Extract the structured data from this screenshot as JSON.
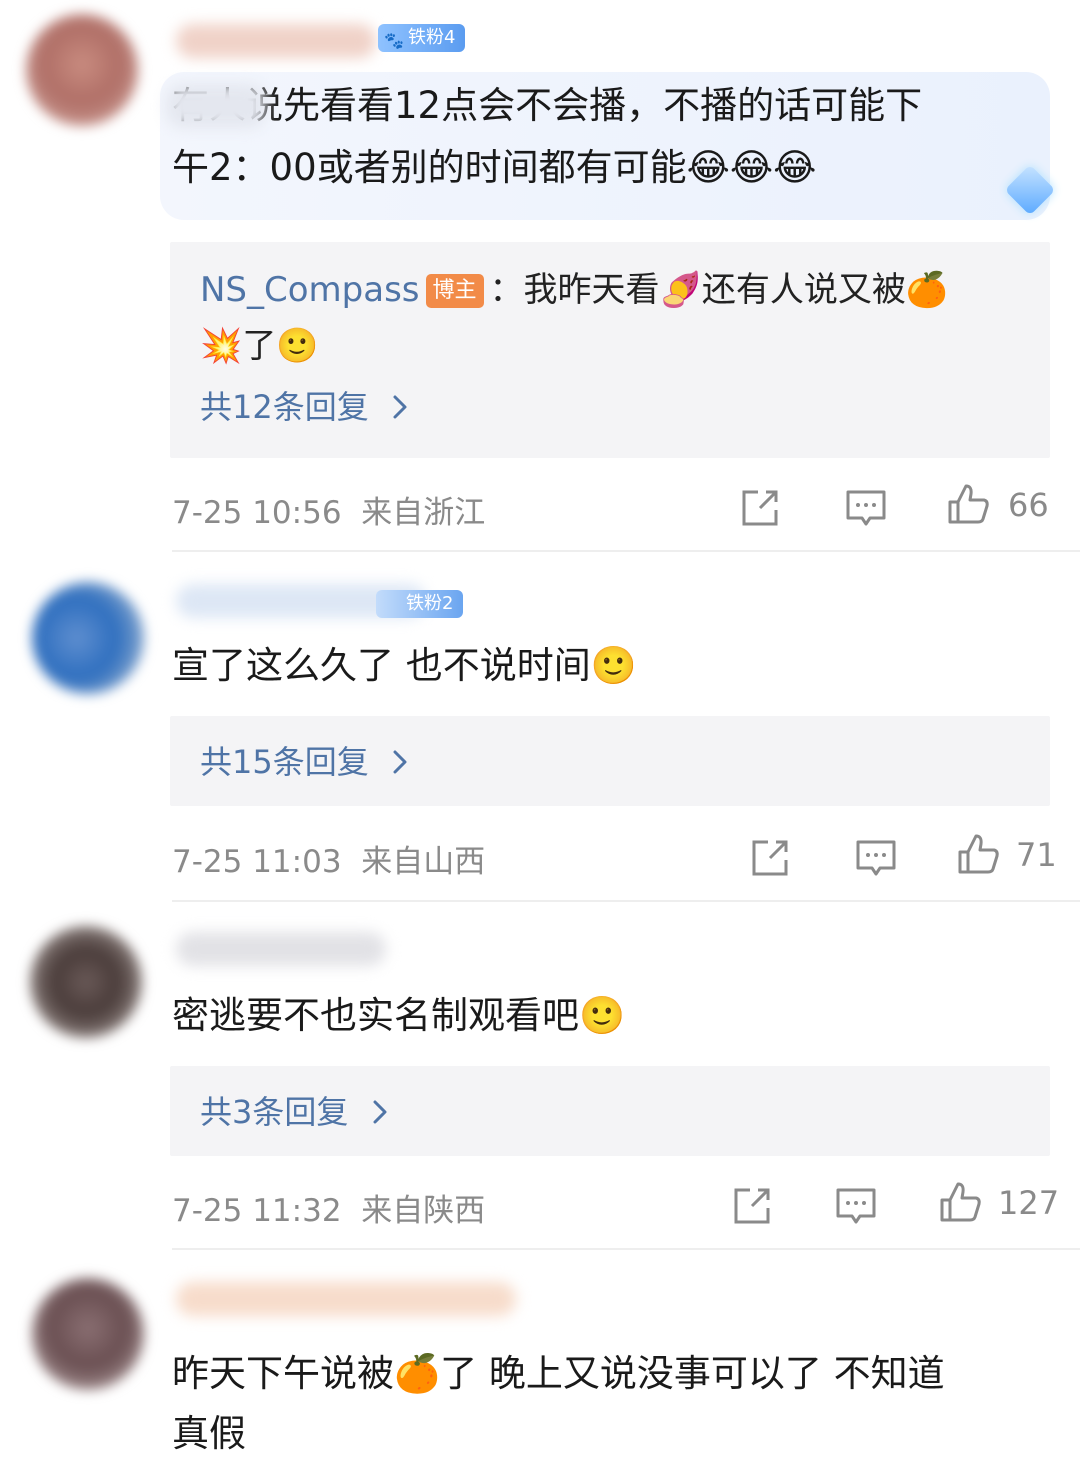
{
  "comments": [
    {
      "fan_badge": "铁粉4",
      "text_line1": "有人说先看看12点会不会播，不播的话可能下",
      "text_line2": "午2：00或者别的时间都有可能",
      "text_emoji": "😂😂😂",
      "reply": {
        "author": "NS_Compass",
        "author_badge": "博主",
        "text_a": "：我昨天看",
        "emoji_a": "🍠",
        "text_b": "还有人说又被",
        "emoji_b": "🍊",
        "emoji_c": "💥",
        "text_c": "了",
        "emoji_d": "🙂"
      },
      "reply_count_label": "共12条回复",
      "date": "7-25 10:56",
      "location": "来自浙江",
      "likes": "66"
    },
    {
      "fan_badge": "铁粉2",
      "text_line1": "宣了这么久了 也不说时间",
      "text_emoji": "🙂",
      "reply_count_label": "共15条回复",
      "date": "7-25 11:03",
      "location": "来自山西",
      "likes": "71"
    },
    {
      "text_line1": "密逃要不也实名制观看吧",
      "text_emoji": "🙂",
      "reply_count_label": "共3条回复",
      "date": "7-25 11:32",
      "location": "来自陕西",
      "likes": "127"
    },
    {
      "text_line1a": "昨天下午说被",
      "text_emoji": "🍊",
      "text_line1b": "了 晚上又说没事可以了 不知道",
      "text_line2": "真假"
    }
  ],
  "colors": {
    "link_blue": "#4f74a6",
    "meta_gray": "#8a8a8a",
    "reply_bg": "#f4f4f6",
    "bozhu_orange": "#f28b48"
  },
  "icons": {
    "share": "share-icon",
    "comment": "comment-icon",
    "like": "thumbs-up-icon",
    "chevron": "chevron-right-icon"
  }
}
